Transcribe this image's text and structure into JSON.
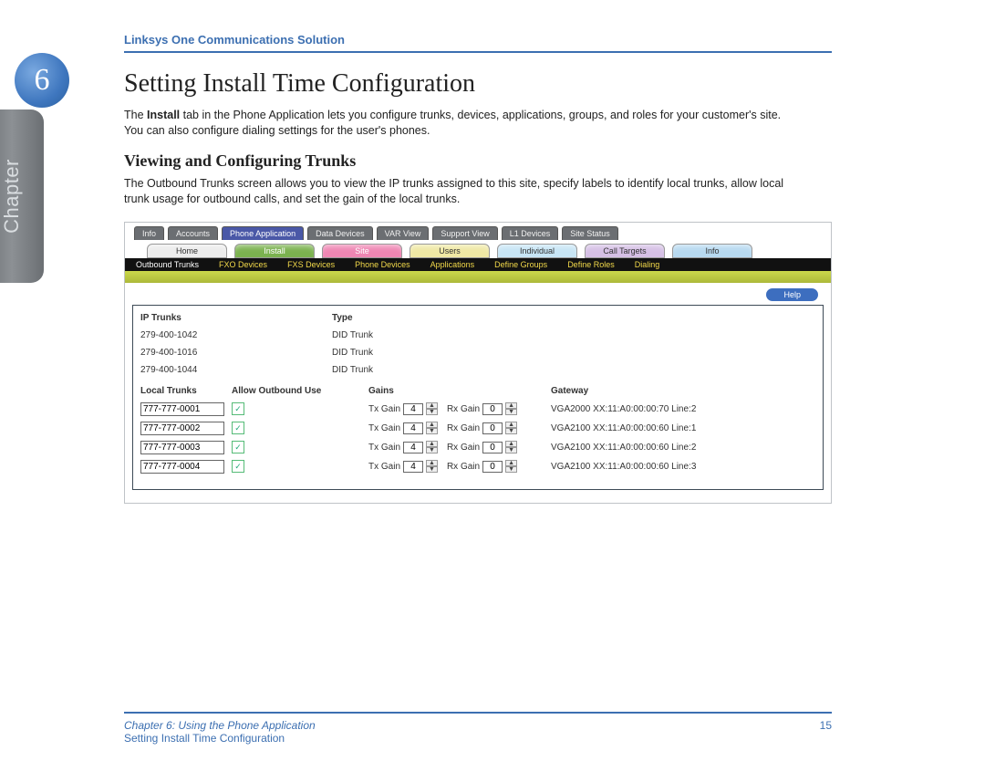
{
  "header": {
    "product": "Linksys One Communications Solution"
  },
  "chapter": {
    "number": "6",
    "tab_label": "Chapter"
  },
  "section": {
    "title": "Setting Install Time Configuration",
    "intro_before_bold": "The ",
    "intro_bold": "Install",
    "intro_after_bold": " tab in the Phone Application lets you configure trunks, devices, applications, groups, and roles for your customer's site. You can also configure dialing settings for the user's phones.",
    "sub_title": "Viewing and Configuring Trunks",
    "sub_body": "The Outbound Trunks screen allows you to view the IP trunks assigned to this site, specify labels to identify local trunks, allow local trunk usage for outbound calls, and set the gain of the local trunks."
  },
  "app": {
    "top_tabs": [
      "Info",
      "Accounts",
      "Phone Application",
      "Data Devices",
      "VAR View",
      "Support View",
      "L1 Devices",
      "Site Status"
    ],
    "active_top_tab": "Phone Application",
    "mid_tabs": [
      "Home",
      "Install",
      "Site",
      "Users",
      "Individual",
      "Call Targets",
      "Info"
    ],
    "black_bar_items": [
      "Outbound Trunks",
      "FXO Devices",
      "FXS Devices",
      "Phone Devices",
      "Applications",
      "Define Groups",
      "Define Roles",
      "Dialing"
    ],
    "help_label": "Help",
    "ip_hdr_a": "IP Trunks",
    "ip_hdr_b": "Type",
    "ip_rows": [
      {
        "num": "279-400-1042",
        "type": "DID Trunk"
      },
      {
        "num": "279-400-1016",
        "type": "DID Trunk"
      },
      {
        "num": "279-400-1044",
        "type": "DID Trunk"
      }
    ],
    "loc_hdr_a": "Local Trunks",
    "loc_hdr_b": "Allow Outbound Use",
    "loc_hdr_c": "Gains",
    "loc_hdr_d": "Gateway",
    "tx_label": "Tx Gain",
    "rx_label": "Rx Gain",
    "loc_rows": [
      {
        "num": "777-777-0001",
        "allow": true,
        "tx": "4",
        "rx": "0",
        "gw": "VGA2000 XX:11:A0:00:00:70 Line:2"
      },
      {
        "num": "777-777-0002",
        "allow": true,
        "tx": "4",
        "rx": "0",
        "gw": "VGA2100 XX:11:A0:00:00:60 Line:1"
      },
      {
        "num": "777-777-0003",
        "allow": true,
        "tx": "4",
        "rx": "0",
        "gw": "VGA2100 XX:11:A0:00:00:60 Line:2"
      },
      {
        "num": "777-777-0004",
        "allow": true,
        "tx": "4",
        "rx": "0",
        "gw": "VGA2100 XX:11:A0:00:00:60 Line:3"
      }
    ]
  },
  "footer": {
    "line1": "Chapter 6: Using the Phone Application",
    "line2": "Setting Install Time Configuration",
    "page": "15"
  }
}
